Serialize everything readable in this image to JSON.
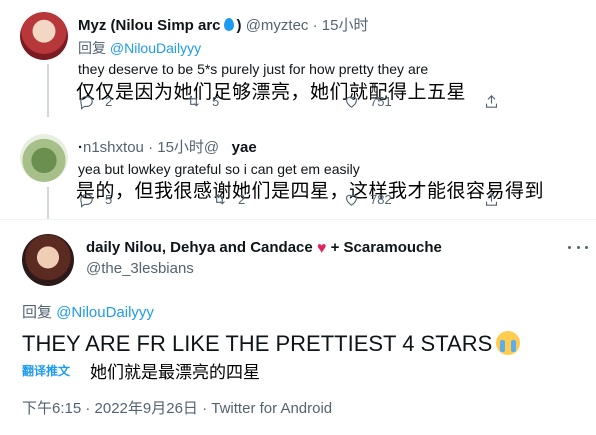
{
  "tweets": [
    {
      "name": "Myz (Nilou Simp arc",
      "name_suffix": ")",
      "handle": "@myztec",
      "time": "· 15小时",
      "reply_prefix": "回复",
      "reply_mention": "@NilouDailyyy",
      "text": "they deserve to be 5*s purely just for how pretty they are",
      "translation": "仅仅是因为她们足够漂亮，她们就配得上五星",
      "reply_count": "2",
      "retweet_count": "5",
      "like_count": "751"
    },
    {
      "name": "·⁧ yae ⁧ ⁧",
      "handle": "@n1shxtou",
      "time": "· 15小时",
      "text": "yea but lowkey grateful so i can get em easily",
      "translation": "是的，但我很感谢她们是四星，这样我才能很容易得到",
      "reply_count": "5",
      "retweet_count": "2",
      "like_count": "782"
    }
  ],
  "main_tweet": {
    "name": "daily Nilou, Dehya and Candace",
    "heart": "♥",
    "name_suffix": "+ Scaramouche",
    "handle": "@the_3lesbians",
    "reply_prefix": "回复",
    "reply_mention": "@NilouDailyyy",
    "text": "THEY ARE FR LIKE THE PRETTIEST 4 STARS",
    "translate_label": "翻译推文",
    "translation": "她们就是最漂亮的四星",
    "timestamp": "下午6:15 · 2022年9月26日 · ",
    "source": "Twitter for Android"
  },
  "icons": {
    "reply": "reply-icon",
    "retweet": "retweet-icon",
    "like": "heart-icon",
    "share": "share-icon",
    "more": "more-icon",
    "emoji": "crying-face-icon"
  },
  "colors": {
    "accent": "#1d9bf0",
    "secondary_text": "#536471",
    "heart": "#e0245e"
  }
}
